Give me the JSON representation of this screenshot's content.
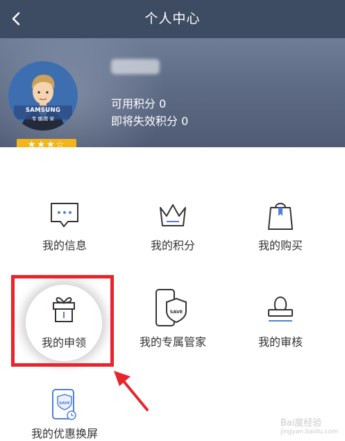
{
  "header": {
    "title": "个人中心",
    "back_icon": "chevron-left-icon"
  },
  "profile": {
    "avatar_brand": "SAMSUNG",
    "avatar_brand_sub": "专 属 管 家",
    "stars": "★★★☆",
    "available_points": "可用积分 0",
    "expiring_points": "即将失效积分 0"
  },
  "menu": [
    {
      "label": "我的信息",
      "icon": "message-bubble-icon"
    },
    {
      "label": "我的积分",
      "icon": "crown-icon"
    },
    {
      "label": "我的购买",
      "icon": "shopping-bag-icon"
    },
    {
      "label": "我的申领",
      "icon": "gift-box-icon"
    },
    {
      "label": "我的专属管家",
      "icon": "phone-shield-icon",
      "icon_text": "SAVE"
    },
    {
      "label": "我的审核",
      "icon": "stamp-icon"
    },
    {
      "label": "我的优惠换屏",
      "icon": "phone-save-clock-icon",
      "icon_text": "SAVE"
    }
  ],
  "watermark": {
    "text": "Bai度经验",
    "sub": "jingyan.baidu.com"
  },
  "colors": {
    "header": "#3e4c63",
    "accent_red": "#e8252b",
    "star_gold": "#f2b51b",
    "icon_blue": "#4f7fd6"
  }
}
